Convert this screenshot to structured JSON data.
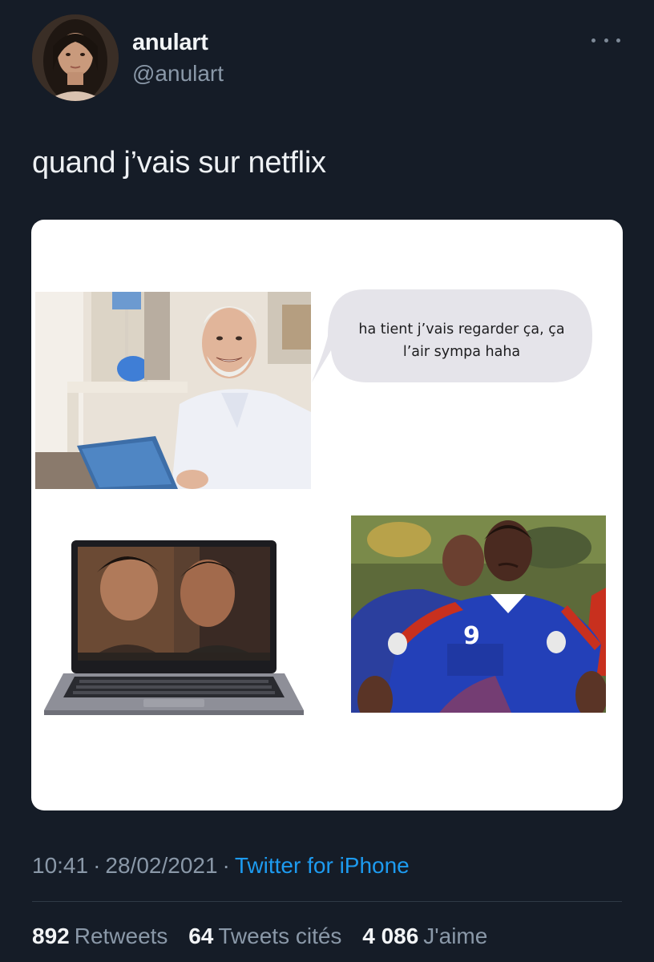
{
  "user": {
    "display_name": "anulart",
    "handle": "@anulart"
  },
  "tweet": {
    "text": "quand j’vais sur netflix"
  },
  "meme": {
    "speech_bubble": "ha tient j’vais regarder ça, ça l’air sympa haha",
    "jersey_number": "9"
  },
  "meta": {
    "time": "10:41",
    "separator": "·",
    "date": "28/02/2021",
    "source": "Twitter for iPhone"
  },
  "stats": [
    {
      "count": "892",
      "label": "Retweets"
    },
    {
      "count": "64",
      "label": "Tweets cités"
    },
    {
      "count": "4 086",
      "label": "J'aime"
    }
  ],
  "colors": {
    "background": "#151c27",
    "link": "#1d9bf0",
    "muted": "#8a98a8"
  },
  "icons": {
    "more": "more-horizontal-icon"
  }
}
